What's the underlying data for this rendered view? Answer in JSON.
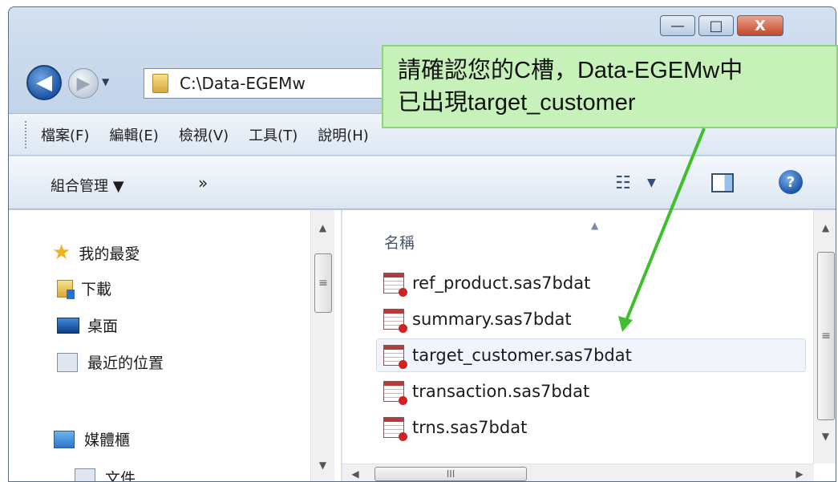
{
  "window": {
    "caption": {
      "minimize": "—",
      "maximize": "□",
      "close": "X"
    },
    "address": {
      "path": "C:\\Data-EGEMw"
    },
    "nav": {
      "back": "◀",
      "forward": "▶",
      "dropdown": "▼"
    }
  },
  "menu": [
    "檔案(F)",
    "編輯(E)",
    "檢視(V)",
    "工具(T)",
    "說明(H)"
  ],
  "toolbar": {
    "organize": "組合管理 ▼",
    "more": "»",
    "view_icon": "list-view-icon",
    "help": "?"
  },
  "sidebar": {
    "items": [
      {
        "label": "我的最愛",
        "icon": "star-icon"
      },
      {
        "label": "下載",
        "icon": "downloads-icon"
      },
      {
        "label": "桌面",
        "icon": "desktop-icon"
      },
      {
        "label": "最近的位置",
        "icon": "recent-places-icon"
      },
      {
        "label": "媒體櫃",
        "icon": "library-icon"
      },
      {
        "label": "文件",
        "icon": "documents-icon"
      }
    ]
  },
  "files": {
    "column_header": "名稱",
    "items": [
      {
        "name": "ref_product.sas7bdat"
      },
      {
        "name": "summary.sas7bdat"
      },
      {
        "name": "target_customer.sas7bdat"
      },
      {
        "name": "transaction.sas7bdat"
      },
      {
        "name": "trns.sas7bdat"
      }
    ],
    "selected_index": 2
  },
  "scroll": {
    "up": "▲",
    "down": "▼",
    "left": "◀",
    "right": "▶",
    "grip_v": "≡",
    "grip_h": "III"
  },
  "callout": {
    "line1": "請確認您的C槽，Data-EGEMw中",
    "line2": "已出現target_customer",
    "accent": "#3fbf2e"
  }
}
